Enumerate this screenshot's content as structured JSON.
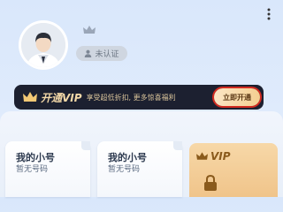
{
  "header": {
    "more_icon": "more-vertical-icon",
    "cert_label": "未认证"
  },
  "vip_banner": {
    "title": "开通VIP",
    "desc": "享受超低折扣, 更多惊喜福利",
    "button_label": "立即开通"
  },
  "accounts": [
    {
      "name": "我的小号",
      "number": "暂无号码"
    },
    {
      "name": "我的小号",
      "number": "暂无号码"
    }
  ],
  "vip_card": {
    "label": "VIP"
  },
  "colors": {
    "banner_bg": "#1c2030",
    "gold": "#f4d9a8",
    "highlight": "#d22a20"
  }
}
